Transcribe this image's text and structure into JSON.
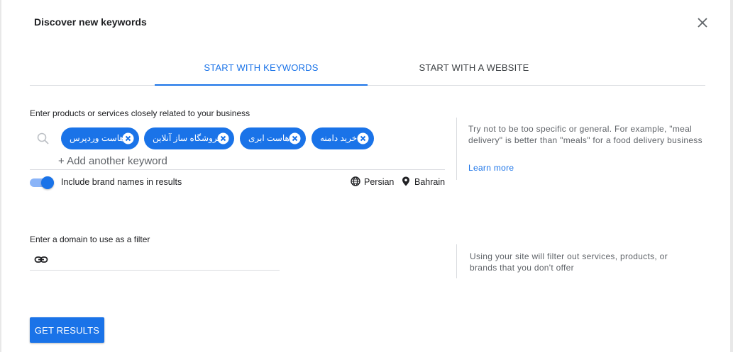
{
  "dialog": {
    "title": "Discover new keywords",
    "close_icon": "close-icon"
  },
  "tabs": [
    {
      "label": "START WITH KEYWORDS",
      "active": true
    },
    {
      "label": "START WITH A WEBSITE",
      "active": false
    }
  ],
  "keywords_section": {
    "label": "Enter products or services closely related to your business",
    "chips": [
      {
        "label": "هاست وردپرس"
      },
      {
        "label": "فروشگاه ساز آنلاین"
      },
      {
        "label": "هاست ابری"
      },
      {
        "label": "خرید دامنه"
      }
    ],
    "add_placeholder": "+ Add another keyword",
    "brand_toggle": {
      "label": "Include brand names in results",
      "on": true
    },
    "language": "Persian",
    "location": "Bahrain",
    "help_text": "Try not to be too specific or general. For example, \"meal delivery\" is better than \"meals\" for a food delivery business",
    "learn_more": "Learn more"
  },
  "domain_section": {
    "label": "Enter a domain to use as a filter",
    "value": "",
    "help_text": "Using your site will filter out services, products, or brands that you don't offer"
  },
  "submit_label": "GET RESULTS",
  "colors": {
    "accent": "#1a73e8",
    "toggle_track": "#8ab4f8",
    "divider": "#dadce0"
  }
}
